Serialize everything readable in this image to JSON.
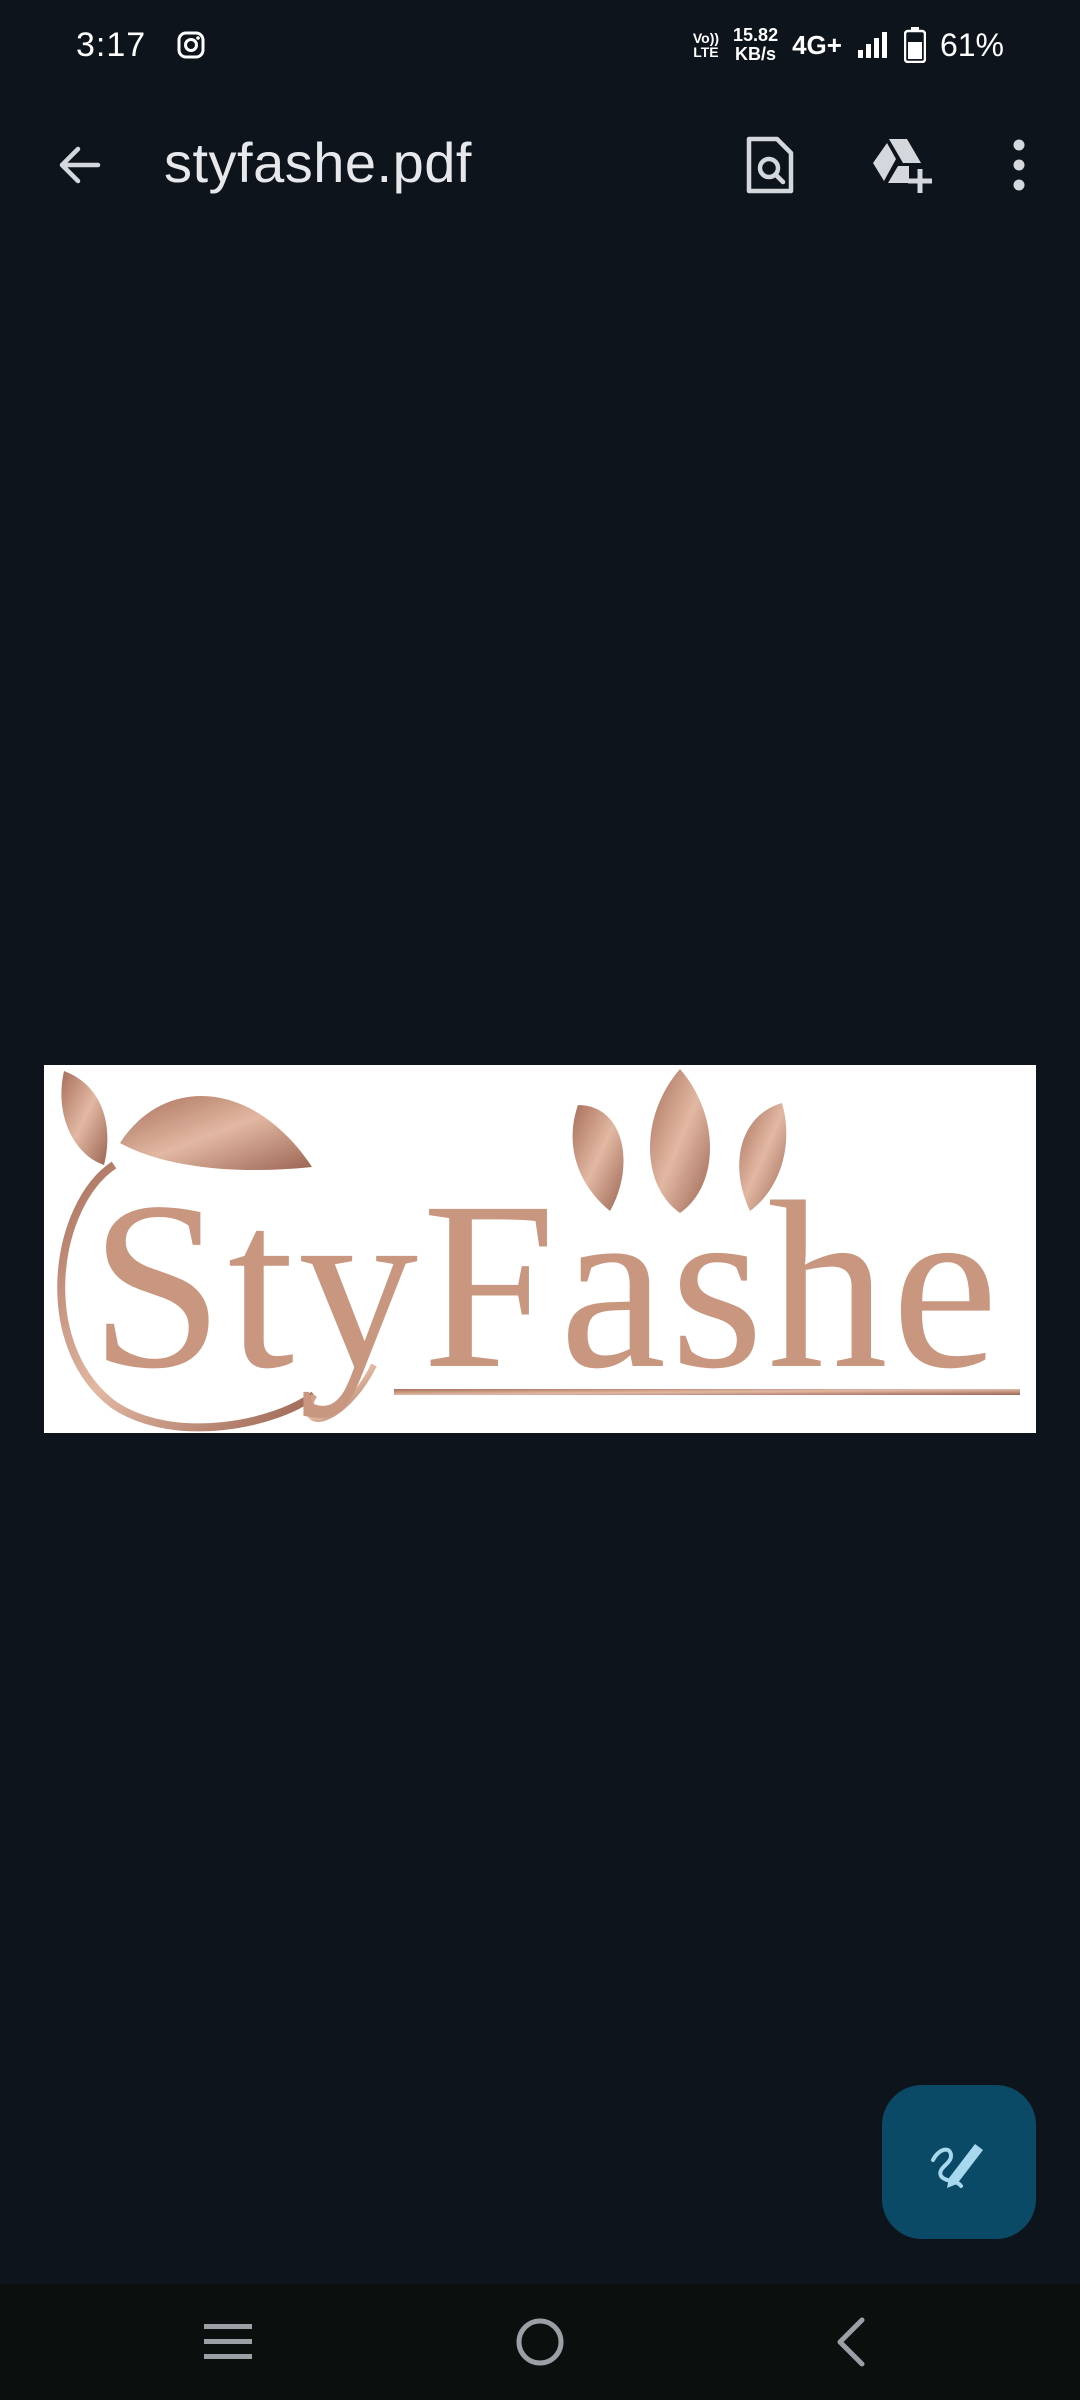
{
  "status_bar": {
    "time": "3:17",
    "volte_line1": "Vo))",
    "volte_line2": "LTE",
    "speed_value": "15.82",
    "speed_unit": "KB/s",
    "network": "4G+",
    "battery": "61%"
  },
  "app_bar": {
    "title": "styfashe.pdf",
    "icons": [
      "back-arrow-icon",
      "find-in-file-icon",
      "add-to-drive-icon",
      "more-vert-icon"
    ]
  },
  "document": {
    "logo_text": "StyFashe",
    "logo_color": "#c9977f"
  },
  "fab": {
    "icon": "annotate-pen-icon",
    "color": "#0b4a66"
  },
  "nav_bar": {
    "icons": [
      "recents-icon",
      "home-icon",
      "back-icon"
    ]
  }
}
